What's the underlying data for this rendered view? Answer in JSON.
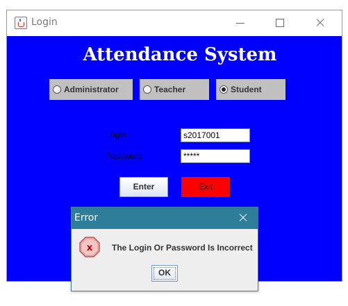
{
  "window": {
    "title": "Login",
    "icon": "java-cup-icon"
  },
  "main": {
    "heading": "Attendance System",
    "roles": [
      {
        "label": "Administrator",
        "selected": false
      },
      {
        "label": "Teacher",
        "selected": false
      },
      {
        "label": "Student",
        "selected": true
      }
    ],
    "login_label": "Login",
    "login_value": "s2017001",
    "password_label": "Password",
    "password_value": "*****",
    "enter_label": "Enter",
    "exit_label": "Exit"
  },
  "dialog": {
    "title": "Error",
    "message": "The Login Or Password Is Incorrect",
    "ok_label": "OK",
    "icon": "error-x-icon"
  },
  "colors": {
    "background": "#0000ff",
    "radio_box": "#c0c0c0",
    "exit_button": "#ff0000",
    "dialog_titlebar": "#2e7e9a"
  }
}
